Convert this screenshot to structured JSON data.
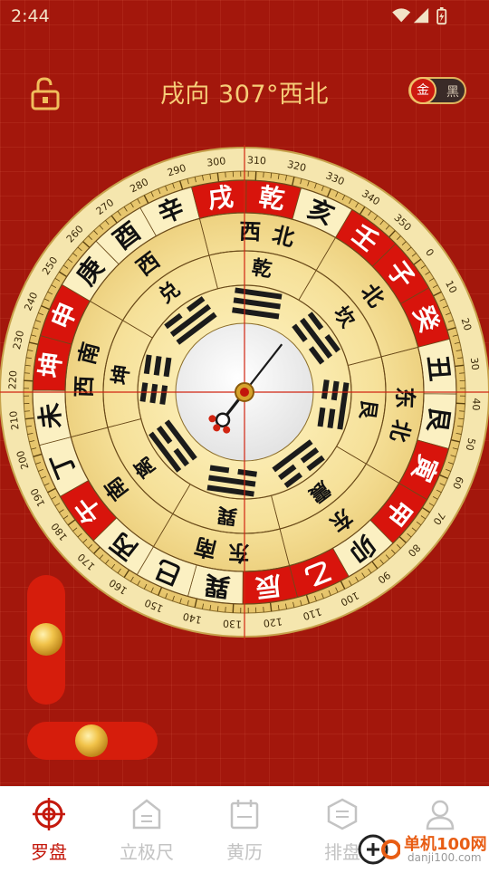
{
  "status_bar": {
    "time": "2:44"
  },
  "header": {
    "heading": "戌向 307°西北",
    "heading_degrees": 307,
    "toggle_active": "金",
    "toggle_inactive": "黑"
  },
  "compass": {
    "needle_angle_deg": 307,
    "outer_ring": [
      "子",
      "癸",
      "丑",
      "艮",
      "寅",
      "甲",
      "卯",
      "乙",
      "辰",
      "巽",
      "巳",
      "丙",
      "午",
      "丁",
      "未",
      "坤",
      "申",
      "庚",
      "酉",
      "辛",
      "戌",
      "乾",
      "亥",
      "壬"
    ],
    "outer_ring_red": [
      "子",
      "癸",
      "寅",
      "甲",
      "乙",
      "辰",
      "午",
      "坤",
      "申",
      "戌",
      "乾",
      "壬"
    ],
    "direction_ring": [
      "北",
      "东北",
      "东",
      "东南",
      "南",
      "西南",
      "西",
      "西北"
    ],
    "trigram_ring": [
      "坎",
      "艮",
      "震",
      "巽",
      "离",
      "坤",
      "兑",
      "乾"
    ],
    "degree_labels": [
      "0",
      "10",
      "20",
      "30",
      "40",
      "50",
      "60",
      "70",
      "80",
      "90",
      "100",
      "110",
      "120",
      "130",
      "140",
      "150",
      "160",
      "170",
      "180",
      "190",
      "200",
      "210",
      "220",
      "230",
      "240",
      "250",
      "260",
      "270",
      "280",
      "290",
      "300",
      "310",
      "320",
      "330",
      "340",
      "350"
    ]
  },
  "sliders": {
    "vertical_value": 0.5,
    "horizontal_value": 0.5
  },
  "tabs": [
    {
      "label": "罗盘",
      "icon": "target-icon",
      "active": true
    },
    {
      "label": "立极尺",
      "icon": "house-icon",
      "active": false
    },
    {
      "label": "黄历",
      "icon": "calendar-icon",
      "active": false
    },
    {
      "label": "排盘",
      "icon": "layout-icon",
      "active": false
    },
    {
      "label": "",
      "icon": "person-icon",
      "active": false
    }
  ],
  "watermark": {
    "text": "单机100网",
    "url": "danji100.com"
  },
  "colors": {
    "background": "#a3170c",
    "accent": "#c4190d",
    "gold": "#f6cd78",
    "dial": "#f5e39f"
  }
}
